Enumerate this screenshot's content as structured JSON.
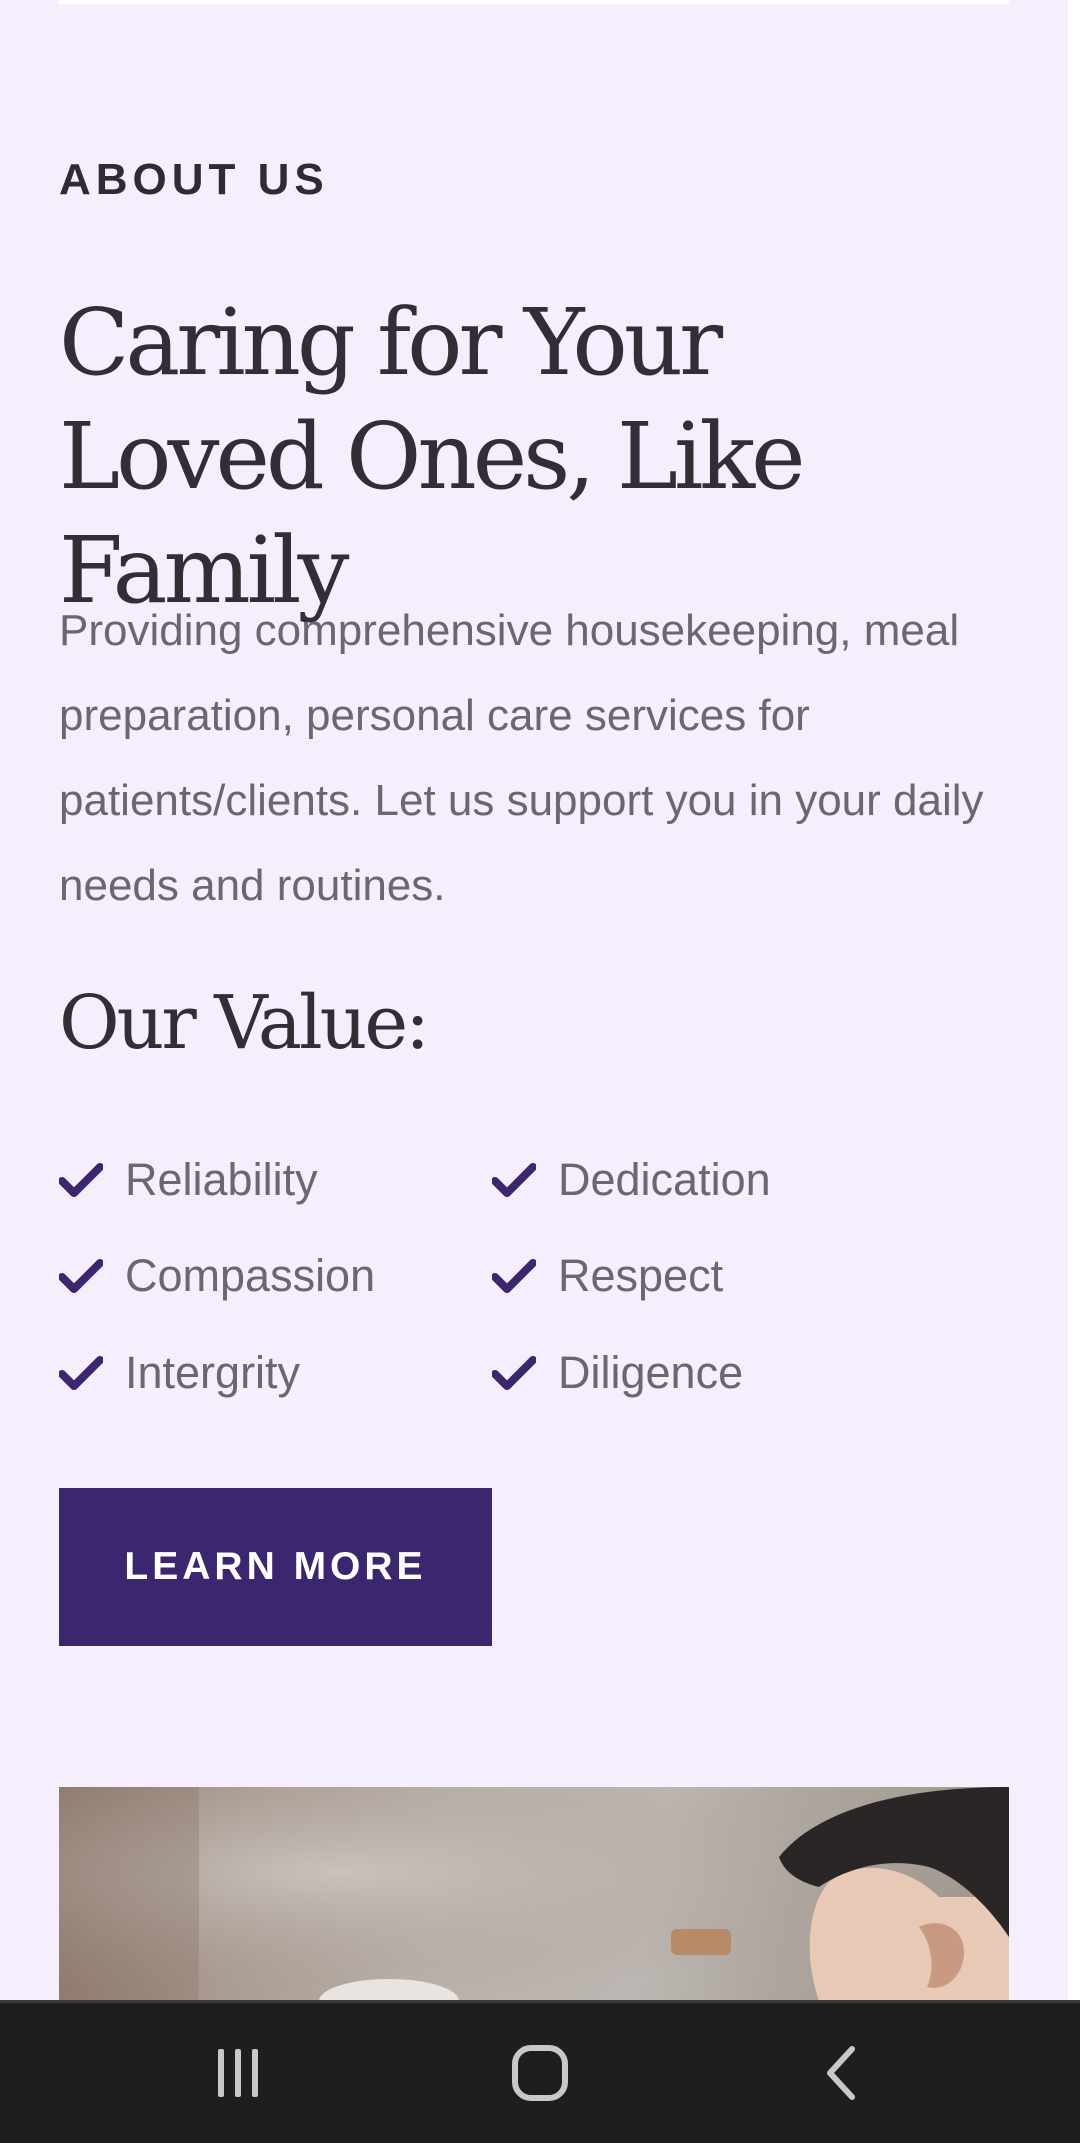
{
  "about": {
    "eyebrow": "ABOUT US",
    "headline": "Caring for Your Loved Ones, Like Family",
    "intro": "Providing comprehensive housekeeping, meal preparation, personal care services for patients/clients. Let us support you in your daily needs and routines."
  },
  "values": {
    "title": "Our Value:",
    "left": [
      "Reliability",
      "Compassion",
      "Intergrity"
    ],
    "right": [
      "Dedication",
      "Respect",
      "Diligence"
    ],
    "check_icon": "check-icon",
    "check_color": "#3d2670"
  },
  "cta": {
    "label": "LEARN MORE",
    "color": "#3d2670"
  },
  "colors": {
    "background": "#f5eefc",
    "heading": "#322e35",
    "body_text": "#6c6671"
  },
  "nav_bar": {
    "recent_icon": "recent-apps-icon",
    "home_icon": "home-icon",
    "back_icon": "back-icon"
  }
}
